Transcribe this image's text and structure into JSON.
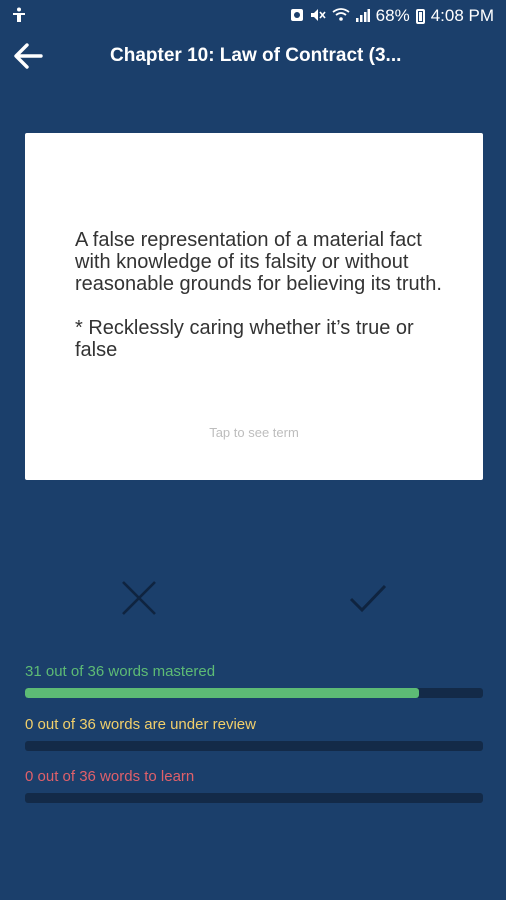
{
  "status_bar": {
    "signal": "68%",
    "time": "4:08 PM"
  },
  "header": {
    "title": "Chapter 10: Law of Contract (3..."
  },
  "card": {
    "definition": "A false representation of a material fact with knowledge of its falsity or without reasonable grounds for believing its truth.\n\n* Recklessly caring whether it’s true or false",
    "hint": "Tap to see term"
  },
  "progress": {
    "mastered": {
      "label": "31 out of 36 words mastered",
      "value": 0.861,
      "color": "#5dbb75"
    },
    "review": {
      "label": "0 out of 36 words are under review",
      "value": 0,
      "color": "#f1cf6b"
    },
    "learn": {
      "label": "0 out of 36 words to learn",
      "value": 0,
      "color": "#e0606a"
    }
  },
  "colors": {
    "background": "#1b3f6b",
    "track": "#132a48",
    "card": "#ffffff"
  }
}
